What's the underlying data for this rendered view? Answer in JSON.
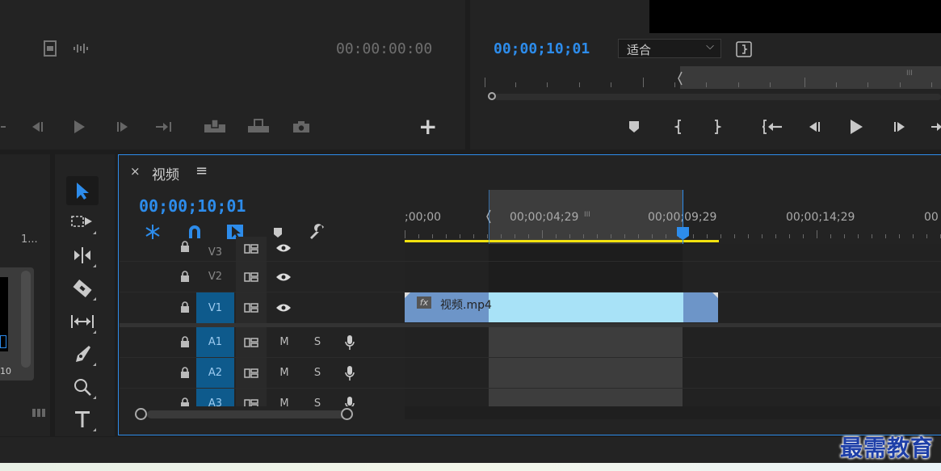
{
  "source_monitor": {
    "timecode": "00:00:00:00",
    "add_symbol": "+"
  },
  "program_monitor": {
    "timecode": "00;00;10;01",
    "zoom_select": "适合",
    "zoom_arrow": "⌵",
    "ruler_mark": "III"
  },
  "project_panel": {
    "truncated_label": "1...",
    "thumb_label": "10"
  },
  "timeline": {
    "close_symbol": "×",
    "title": "视频",
    "menu_symbol": "≡",
    "timecode": "00;00;10;01",
    "ruler_labels": [
      ";00;00",
      "00;00;04;29",
      "00;00;09;29",
      "00;00;14;29",
      "00"
    ],
    "ruler_mid_mark": "III",
    "tracks": [
      {
        "name": "V3"
      },
      {
        "name": "V2"
      },
      {
        "name": "V1"
      },
      {
        "name": "A1",
        "m": "M",
        "s": "S"
      },
      {
        "name": "A2",
        "m": "M",
        "s": "S"
      },
      {
        "name": "A3",
        "m": "M",
        "s": "S"
      }
    ],
    "clip": {
      "fx": "fx",
      "name": "视频.mp4"
    }
  },
  "watermark": "最需教育",
  "colors": {
    "accent_blue": "#2d8ceb",
    "track_target_blue": "#0e5a8c",
    "clip_light": "#a8e2f7",
    "clip_dark": "#6d95c8",
    "work_area_yellow": "#f2e20f",
    "panel_bg": "#232323"
  }
}
